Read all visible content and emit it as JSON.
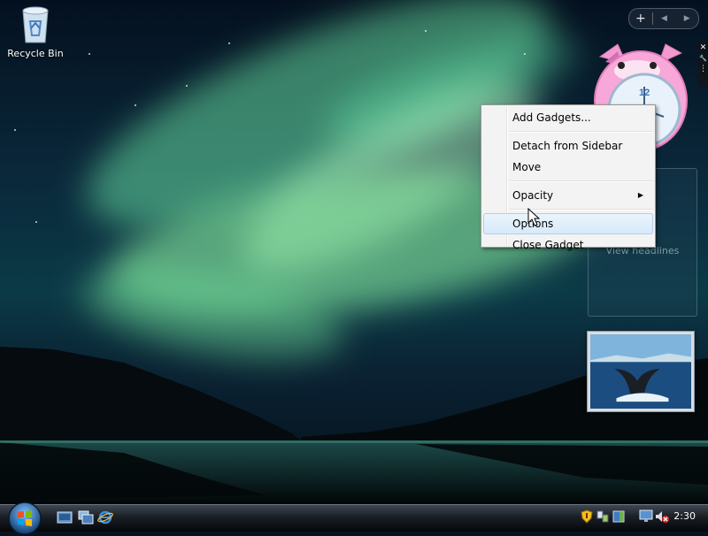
{
  "desktop": {
    "icons": [
      {
        "label": "Recycle Bin",
        "icon": "recycle-bin-icon"
      }
    ]
  },
  "sidebar": {
    "add_symbol": "+",
    "prev_symbol": "◀",
    "next_symbol": "▶",
    "gadget_tools": {
      "close_symbol": "✕",
      "options_symbol": "🔧",
      "drag_symbol": "⋮"
    },
    "clock_gadget": {
      "icon": "cat-clock-icon",
      "numeral": "12"
    },
    "feed_gadget": {
      "link_text": "View headlines"
    },
    "slideshow_gadget": {
      "icon": "whale-tail-photo"
    }
  },
  "context_menu": {
    "items": [
      {
        "label": "Add Gadgets..."
      },
      {
        "label": "Detach from Sidebar"
      },
      {
        "label": "Move"
      },
      {
        "label": "Opacity",
        "submenu_symbol": "▶"
      },
      {
        "label": "Options",
        "highlighted": true
      },
      {
        "label": "Close Gadget"
      }
    ]
  },
  "taskbar": {
    "quick_launch": [
      "show-desktop-icon",
      "switch-windows-icon",
      "internet-explorer-icon"
    ],
    "tray_icons": [
      "security-shield-icon",
      "network-icon",
      "sidebar-icon",
      "display-icon",
      "volume-muted-icon"
    ],
    "clock": "2:30"
  },
  "colors": {
    "menu_bg": "#f3f3f3",
    "menu_highlight": "#d7eaf9",
    "taskbar": "#1a1f25"
  }
}
